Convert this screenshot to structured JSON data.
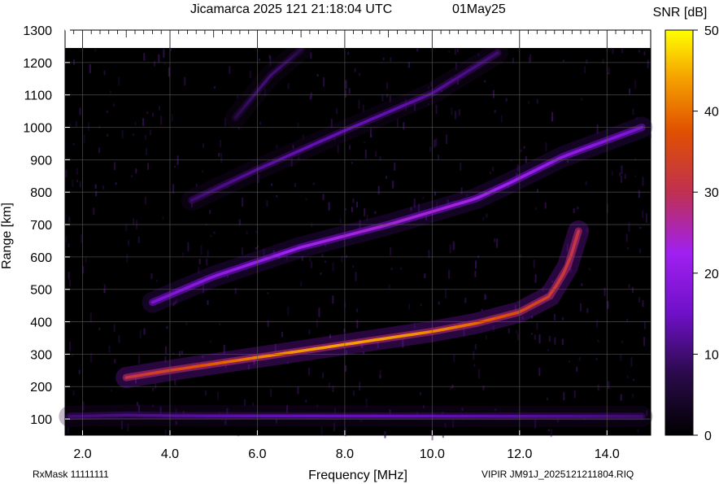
{
  "chart_data": {
    "type": "heatmap",
    "title": "Jicamarca 2025 121 21:18:04 UTC",
    "date_label": "01May25",
    "xlabel": "Frequency [MHz]",
    "ylabel": "Range [km]",
    "xlim": [
      1.6,
      15.0
    ],
    "ylim": [
      50,
      1300
    ],
    "x_ticks": [
      2.0,
      4.0,
      6.0,
      8.0,
      10.0,
      12.0,
      14.0
    ],
    "x_tick_labels": [
      "2.0",
      "4.0",
      "6.0",
      "8.0",
      "10.0",
      "12.0",
      "14.0"
    ],
    "y_ticks": [
      100,
      200,
      300,
      400,
      500,
      600,
      700,
      800,
      900,
      1000,
      1100,
      1200,
      1300
    ],
    "y_tick_labels": [
      "100",
      "200",
      "300",
      "400",
      "500",
      "600",
      "700",
      "800",
      "900",
      "1000",
      "1100",
      "1200",
      "1300"
    ],
    "grid": true,
    "colorbar": {
      "label": "SNR [dB]",
      "range": [
        0,
        50
      ],
      "ticks": [
        0,
        10,
        20,
        30,
        40,
        50
      ],
      "tick_labels": [
        "0",
        "10",
        "20",
        "30",
        "40",
        "50"
      ]
    },
    "traces": [
      {
        "name_hint": "E",
        "points": [
          [
            1.7,
            108
          ],
          [
            3.0,
            112
          ],
          [
            4.0,
            110
          ],
          [
            14.8,
            108
          ]
        ],
        "snr": 14
      },
      {
        "name_hint": "F1",
        "points": [
          [
            3.0,
            228
          ],
          [
            4.0,
            250
          ],
          [
            6.0,
            290
          ],
          [
            8.0,
            330
          ],
          [
            10.0,
            370
          ],
          [
            11.0,
            395
          ],
          [
            12.0,
            430
          ],
          [
            12.7,
            480
          ],
          [
            13.1,
            570
          ],
          [
            13.35,
            680
          ]
        ],
        "snr": 44
      },
      {
        "name_hint": "F2",
        "points": [
          [
            3.6,
            460
          ],
          [
            5.0,
            540
          ],
          [
            7.0,
            630
          ],
          [
            9.0,
            700
          ],
          [
            10.0,
            740
          ],
          [
            11.0,
            780
          ],
          [
            11.8,
            830
          ],
          [
            13.0,
            910
          ],
          [
            14.8,
            1000
          ]
        ],
        "snr": 24
      },
      {
        "name_hint": "F3",
        "points": [
          [
            4.5,
            775
          ],
          [
            6.0,
            870
          ],
          [
            8.0,
            990
          ],
          [
            10.0,
            1105
          ],
          [
            11.5,
            1230
          ]
        ],
        "snr": 14
      },
      {
        "name_hint": "F4",
        "points": [
          [
            5.5,
            1030
          ],
          [
            6.3,
            1160
          ],
          [
            7.0,
            1240
          ]
        ],
        "snr": 10
      }
    ]
  },
  "footer": {
    "rxmask": "RxMask 11111111",
    "file": "VIPIR  JM91J_2025121211804.RIQ"
  }
}
